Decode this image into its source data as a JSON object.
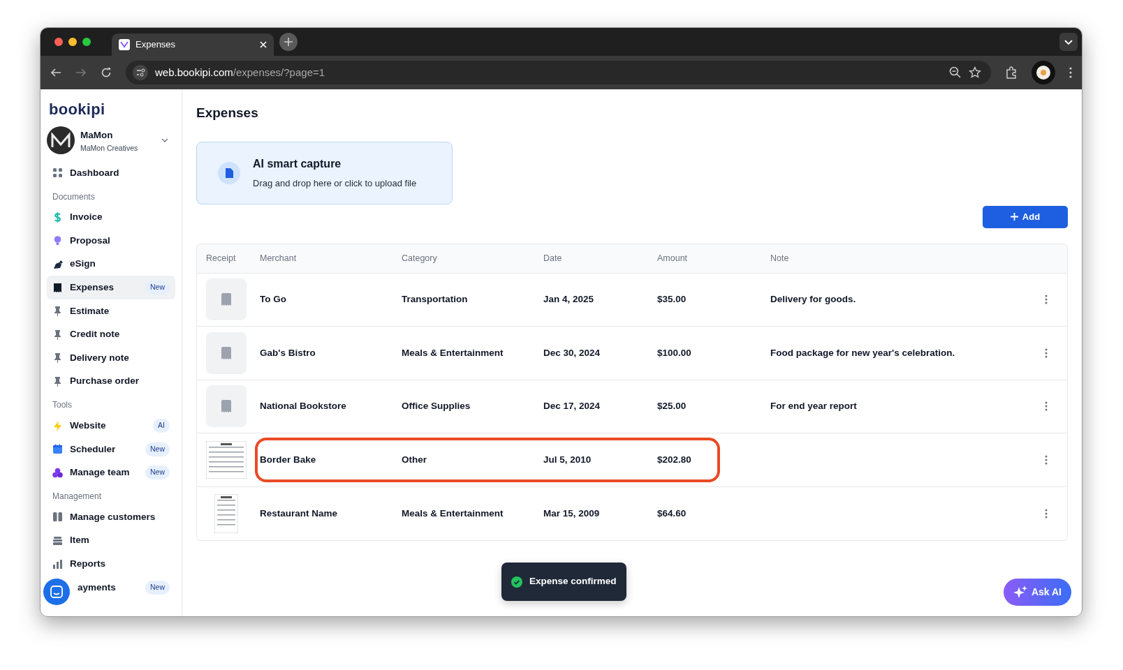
{
  "browser": {
    "tab_title": "Expenses",
    "url_host": "web.bookipi.com",
    "url_path": "/expenses/?page=1"
  },
  "sidebar": {
    "logo": "bookipi",
    "account": {
      "name": "MaMon",
      "company": "MaMon Creatives"
    },
    "sections": [
      {
        "items": [
          {
            "label": "Dashboard",
            "selected": false
          }
        ]
      },
      {
        "title": "Documents",
        "items": [
          {
            "label": "Invoice",
            "selected": false
          },
          {
            "label": "Proposal",
            "selected": false
          },
          {
            "label": "eSign",
            "selected": false
          },
          {
            "label": "Expenses",
            "badge": "New",
            "selected": true
          },
          {
            "label": "Estimate",
            "selected": false
          },
          {
            "label": "Credit note",
            "selected": false
          },
          {
            "label": "Delivery note",
            "selected": false
          },
          {
            "label": "Purchase order",
            "selected": false
          }
        ]
      },
      {
        "title": "Tools",
        "items": [
          {
            "label": "Website",
            "badge": "AI",
            "selected": false
          },
          {
            "label": "Scheduler",
            "badge": "New",
            "selected": false
          },
          {
            "label": "Manage team",
            "badge": "New",
            "selected": false
          }
        ]
      },
      {
        "title": "Management",
        "items": [
          {
            "label": "Manage customers",
            "selected": false
          },
          {
            "label": "Item",
            "selected": false
          },
          {
            "label": "Reports",
            "selected": false
          },
          {
            "label": "ayments",
            "badge": "New",
            "selected": false
          }
        ]
      }
    ]
  },
  "page": {
    "title": "Expenses",
    "capture": {
      "title": "AI smart capture",
      "subtitle": "Drag and drop here or click to upload file"
    },
    "add_button": "Add"
  },
  "table": {
    "columns": [
      "Receipt",
      "Merchant",
      "Category",
      "Date",
      "Amount",
      "Note"
    ],
    "rows": [
      {
        "receipt": {
          "kind": "placeholder"
        },
        "merchant": "To Go",
        "category": "Transportation",
        "date": "Jan 4, 2025",
        "amount": "$35.00",
        "note": "Delivery for goods.",
        "highlighted": false
      },
      {
        "receipt": {
          "kind": "placeholder"
        },
        "merchant": "Gab's Bistro",
        "category": "Meals & Entertainment",
        "date": "Dec 30, 2024",
        "amount": "$100.00",
        "note": "Food package for new year's celebration.",
        "highlighted": false
      },
      {
        "receipt": {
          "kind": "placeholder"
        },
        "merchant": "National Bookstore",
        "category": "Office Supplies",
        "date": "Dec 17, 2024",
        "amount": "$25.00",
        "note": "For end year report",
        "highlighted": false
      },
      {
        "merchant": "Border Bake",
        "category": "Other",
        "date": "Jul 5, 2010",
        "amount": "$202.80",
        "highlighted": true
      },
      {
        "merchant": "Restaurant Name",
        "category": "Meals & Entertainment",
        "date": "Mar 15, 2009",
        "amount": "$64.60",
        "highlighted": false
      }
    ]
  },
  "toast": {
    "message": "Expense confirmed"
  },
  "ask_ai": "Ask AI"
}
